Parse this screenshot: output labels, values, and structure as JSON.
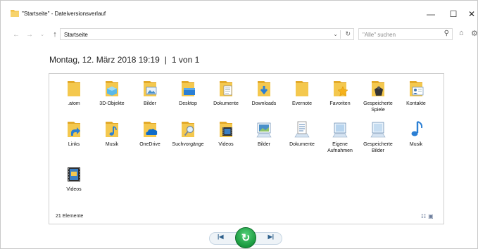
{
  "window": {
    "title": "\"Startseite\" - Dateiversionsverlauf",
    "minimize": "—",
    "maximize": "☐",
    "close": "✕"
  },
  "nav": {
    "back": "←",
    "forward": "→",
    "recent": "⌄",
    "up": "↑",
    "address": "Startseite",
    "dropdown": "⌄",
    "refresh": "↻",
    "search_placeholder": "\"Alle\" suchen",
    "search_icon": "⚲",
    "home_icon": "⌂",
    "settings_icon": "⚙"
  },
  "header": {
    "datetime": "Montag, 12. März 2018 19:19",
    "separator": "|",
    "page": "1 von 1"
  },
  "items": [
    {
      "label": ".atom",
      "icon": "folder-icon"
    },
    {
      "label": "3D-Objekte",
      "icon": "3d-objects-folder-icon"
    },
    {
      "label": "Bilder",
      "icon": "pictures-folder-icon"
    },
    {
      "label": "Desktop",
      "icon": "desktop-folder-icon"
    },
    {
      "label": "Dokumente",
      "icon": "documents-folder-icon"
    },
    {
      "label": "Downloads",
      "icon": "downloads-folder-icon"
    },
    {
      "label": "Evernote",
      "icon": "folder-icon"
    },
    {
      "label": "Favoriten",
      "icon": "favorites-folder-icon"
    },
    {
      "label": "Gespeicherte Spiele",
      "icon": "saved-games-folder-icon"
    },
    {
      "label": "Kontakte",
      "icon": "contacts-folder-icon"
    },
    {
      "label": "Links",
      "icon": "links-folder-icon"
    },
    {
      "label": "Musik",
      "icon": "music-folder-icon"
    },
    {
      "label": "OneDrive",
      "icon": "onedrive-folder-icon"
    },
    {
      "label": "Suchvorgänge",
      "icon": "searches-folder-icon"
    },
    {
      "label": "Videos",
      "icon": "videos-folder-icon"
    },
    {
      "label": "Bilder",
      "icon": "pictures-library-icon"
    },
    {
      "label": "Dokumente",
      "icon": "documents-library-icon"
    },
    {
      "label": "Eigene Aufnahmen",
      "icon": "camera-roll-library-icon"
    },
    {
      "label": "Gespeicherte Bilder",
      "icon": "saved-pictures-library-icon"
    },
    {
      "label": "Musik",
      "icon": "music-library-icon"
    },
    {
      "label": "Videos",
      "icon": "videos-library-icon"
    }
  ],
  "status": {
    "count": "21 Elemente"
  },
  "controls": {
    "previous": "|◀",
    "restore": "↻",
    "next": "▶|"
  },
  "colors": {
    "folder": "#f4c84e",
    "folder_dark": "#e3aa2a",
    "accent_blue": "#2b7fd4",
    "restore_green": "#1a9a3f"
  }
}
